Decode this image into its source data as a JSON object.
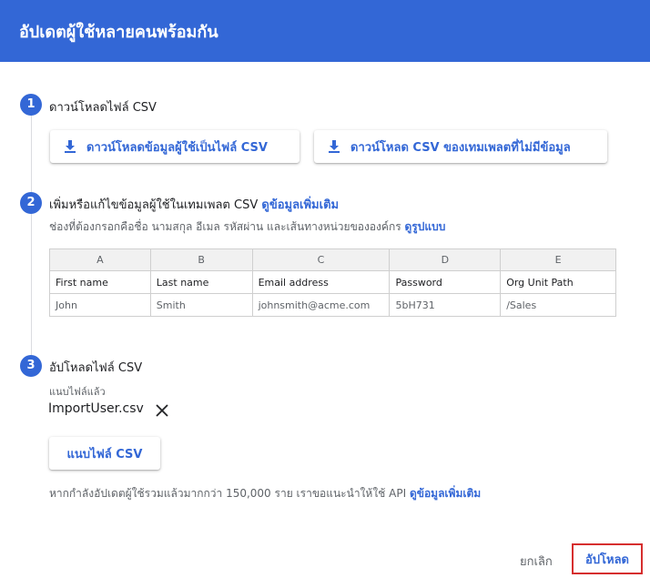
{
  "dialog": {
    "title": "อัปเดตผู้ใช้หลายคนพร้อมกัน"
  },
  "step1": {
    "number": "1",
    "title": "ดาวน์โหลดไฟล์ CSV",
    "download_users_label": "ดาวน์โหลดข้อมูลผู้ใช้เป็นไฟล์ CSV",
    "download_template_label": "ดาวน์โหลด CSV ของเทมเพลตที่ไม่มีข้อมูล"
  },
  "step2": {
    "number": "2",
    "title": "เพิ่มหรือแก้ไขข้อมูลผู้ใช้ในเทมเพลต CSV",
    "more_info_link": "ดูข้อมูลเพิ่มเติม",
    "required_text": "ช่องที่ต้องกรอกคือชื่อ นามสกุล อีเมล รหัสผ่าน และเส้นทางหน่วยขององค์กร",
    "format_link": "ดูรูปแบบ",
    "sheet": {
      "columns": [
        "A",
        "B",
        "C",
        "D",
        "E"
      ],
      "headers": [
        "First name",
        "Last name",
        "Email address",
        "Password",
        "Org Unit Path"
      ],
      "row": [
        "John",
        "Smith",
        "johnsmith@acme.com",
        "5bH731",
        "/Sales"
      ]
    }
  },
  "step3": {
    "number": "3",
    "title": "อัปโหลดไฟล์ CSV",
    "attached_label": "แนบไฟล์แล้ว",
    "file_name": "ImportUser.csv",
    "attach_button_label": "แนบไฟล์ CSV",
    "note_text": "หากกำลังอัปเดตผู้ใช้รวมแล้วมากกว่า 150,000 ราย เราขอแนะนำให้ใช้ API",
    "note_link": "ดูข้อมูลเพิ่มเติม"
  },
  "footer": {
    "cancel_label": "ยกเลิก",
    "upload_label": "อัปโหลด"
  },
  "icons": {
    "download": "download-icon",
    "remove": "close-icon"
  },
  "colors": {
    "accent": "#3367d6",
    "highlight_border": "#d62e2e"
  }
}
